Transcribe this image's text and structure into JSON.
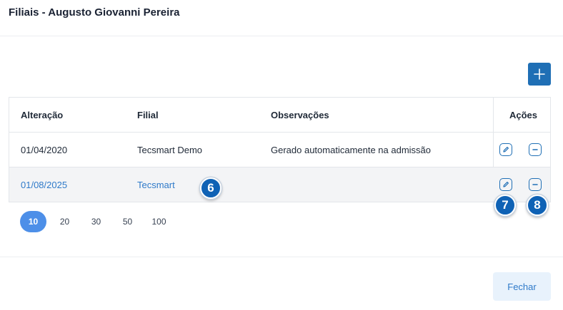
{
  "modal": {
    "title": "Filiais - Augusto Giovanni Pereira"
  },
  "table": {
    "columns": [
      "Alteração",
      "Filial",
      "Observações",
      "Ações"
    ],
    "rows": [
      {
        "alteracao": "01/04/2020",
        "filial": "Tecsmart Demo",
        "observacoes": "Gerado automaticamente na admissão"
      },
      {
        "alteracao": "01/08/2025",
        "filial": "Tecsmart",
        "observacoes": ""
      }
    ]
  },
  "pagination": {
    "options": [
      "10",
      "20",
      "30",
      "50",
      "100"
    ],
    "selected": "10"
  },
  "annotations": [
    "6",
    "7",
    "8"
  ],
  "footer": {
    "close_label": "Fechar"
  },
  "colors": {
    "primary": "#1f6fb5",
    "link": "#2f7ac9",
    "badge": "#0f62b5",
    "pager_active": "#4d8fe8"
  },
  "icons": {
    "add": "plus-icon",
    "edit": "edit-pencil-icon",
    "remove": "minus-circle-icon"
  }
}
